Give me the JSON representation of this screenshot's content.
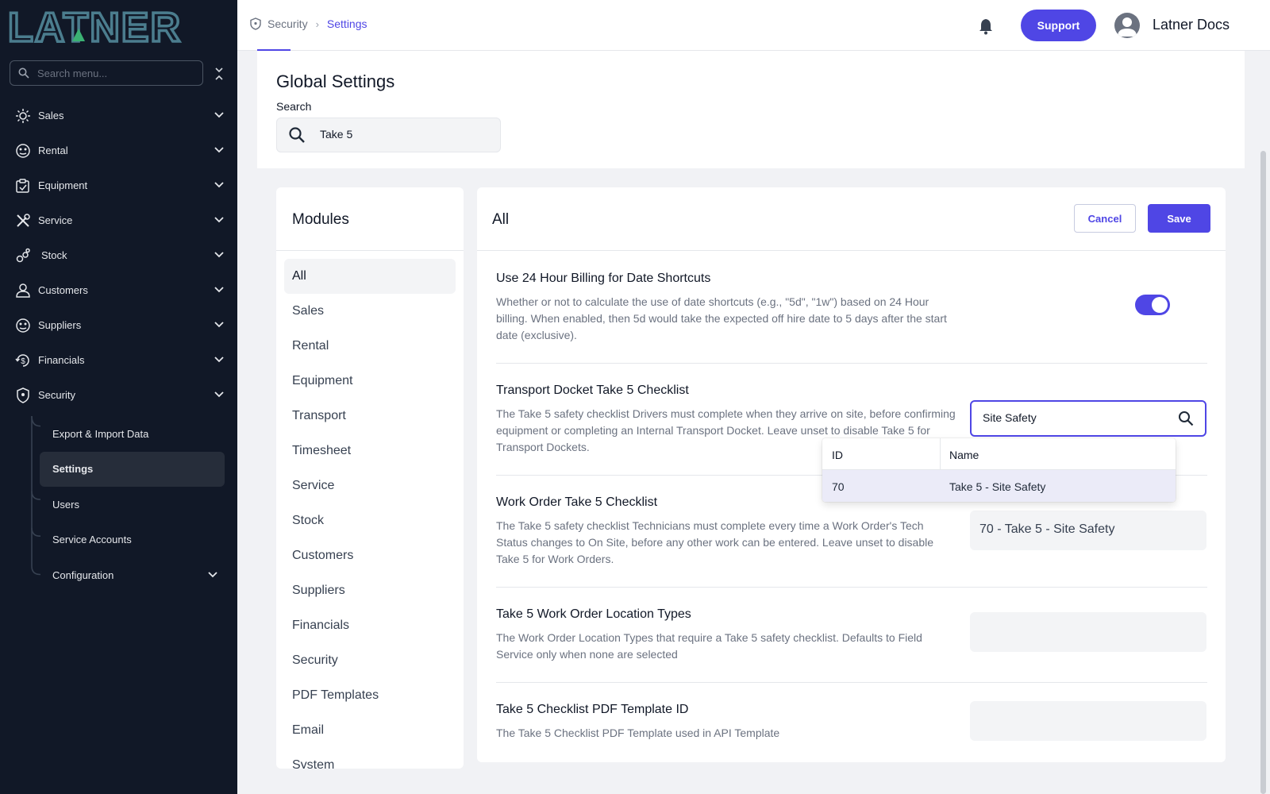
{
  "app": {
    "logo_text": "LATNER"
  },
  "sidebar": {
    "search_placeholder": "Search menu...",
    "items": [
      {
        "label": "Sales",
        "icon": "sales-icon"
      },
      {
        "label": "Rental",
        "icon": "rental-icon"
      },
      {
        "label": "Equipment",
        "icon": "equipment-icon"
      },
      {
        "label": "Service",
        "icon": "service-icon"
      },
      {
        "label": "Stock",
        "icon": "stock-icon"
      },
      {
        "label": "Customers",
        "icon": "customers-icon"
      },
      {
        "label": "Suppliers",
        "icon": "suppliers-icon"
      },
      {
        "label": "Financials",
        "icon": "financials-icon"
      },
      {
        "label": "Security",
        "icon": "shield-icon"
      }
    ],
    "security_sub": [
      {
        "label": "Export & Import Data"
      },
      {
        "label": "Settings"
      },
      {
        "label": "Users"
      },
      {
        "label": "Service Accounts"
      },
      {
        "label": "Configuration"
      }
    ]
  },
  "header": {
    "breadcrumb": [
      "Security",
      "Settings"
    ],
    "support_label": "Support",
    "user_name": "Latner Docs"
  },
  "global": {
    "title": "Global Settings",
    "search_label": "Search",
    "search_value": "Take 5"
  },
  "modules": {
    "title": "Modules",
    "items": [
      "All",
      "Sales",
      "Rental",
      "Equipment",
      "Transport",
      "Timesheet",
      "Service",
      "Stock",
      "Customers",
      "Suppliers",
      "Financials",
      "Security",
      "PDF Templates",
      "Email",
      "System"
    ],
    "active": "All"
  },
  "settings": {
    "title": "All",
    "cancel_label": "Cancel",
    "save_label": "Save",
    "rows": [
      {
        "title": "Use 24 Hour Billing for Date Shortcuts",
        "description": "Whether or not to calculate the use of date shortcuts (e.g., \"5d\", \"1w\") based on 24 Hour billing. When enabled, then 5d would take the expected off hire date to 5 days after the start date (exclusive).",
        "enabled": true
      },
      {
        "title": "Transport Docket Take 5 Checklist",
        "description": "The Take 5 safety checklist Drivers must complete when they arrive on site, before confirming equipment or completing an Internal Transport Docket. Leave unset to disable Take 5 for Transport Dockets.",
        "value": "Site Safety"
      },
      {
        "title": "Work Order Take 5 Checklist",
        "description": "The Take 5 safety checklist Technicians must complete every time a Work Order's Tech Status changes to On Site, before any other work can be entered. Leave unset to disable Take 5 for Work Orders.",
        "value": "70 - Take 5 - Site Safety"
      },
      {
        "title": "Take 5 Work Order Location Types",
        "description": "The Work Order Location Types that require a Take 5 safety checklist. Defaults to Field Service only when none are selected",
        "value": ""
      },
      {
        "title": "Take 5 Checklist PDF Template ID",
        "description": "The Take 5 Checklist PDF Template used in API Template",
        "value": ""
      }
    ]
  },
  "lookup_dropdown": {
    "columns": [
      "ID",
      "Name"
    ],
    "rows": [
      {
        "id": "70",
        "name": "Take 5 - Site Safety"
      }
    ]
  },
  "colors": {
    "accent": "#4f46e5",
    "sidebar_bg": "#111827"
  }
}
